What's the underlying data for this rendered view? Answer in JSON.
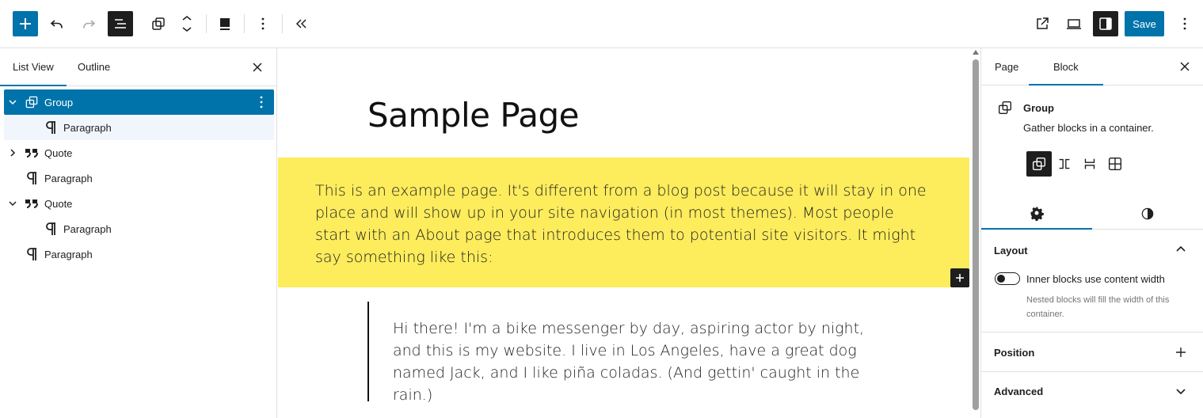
{
  "toolbar": {
    "save_label": "Save",
    "icons": [
      "plus-icon",
      "undo-icon",
      "redo-icon",
      "list-view-icon",
      "group-icon",
      "move-up-down-icon",
      "block-style-icon",
      "options-icon",
      "collapse-icon",
      "view-external-icon",
      "device-preview-icon",
      "settings-icon",
      "more-options-icon"
    ]
  },
  "left_panel": {
    "tabs": [
      "List View",
      "Outline"
    ],
    "rows": [
      {
        "label": "Group"
      },
      {
        "label": "Paragraph"
      },
      {
        "label": "Quote"
      },
      {
        "label": "Paragraph"
      },
      {
        "label": "Quote"
      },
      {
        "label": "Paragraph"
      },
      {
        "label": "Paragraph"
      }
    ]
  },
  "canvas": {
    "title": "Sample Page",
    "group_text": "This is an example page. It's different from a blog post because it will stay in one place and will show up in your site navigation (in most themes). Most people start with an About page that introduces them to potential site visitors. It might say something like this:",
    "quote_text": "Hi there! I'm a bike messenger by day, aspiring actor by night, and this is my website. I live in Los Angeles, have a great dog named Jack, and I like piña coladas. (And gettin' caught in the rain.)",
    "group_bg": "#fdec5c"
  },
  "right_panel": {
    "tabs": [
      "Page",
      "Block"
    ],
    "block_title": "Group",
    "block_desc": "Gather blocks in a container.",
    "layout_label": "Layout",
    "toggle_label": "Inner blocks use content width",
    "toggle_help": "Nested blocks will fill the width of this container.",
    "position_label": "Position",
    "advanced_label": "Advanced"
  },
  "colors": {
    "accent": "#0073aa",
    "dark": "#1e1e1e"
  }
}
